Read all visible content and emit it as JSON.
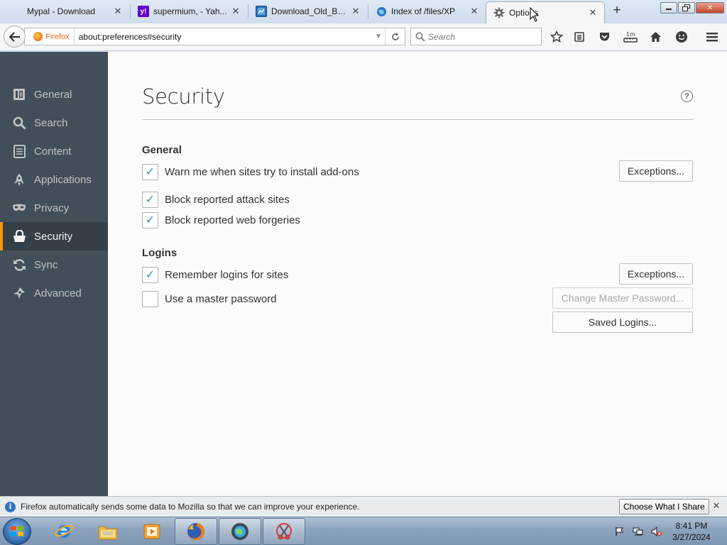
{
  "tabs": [
    {
      "title": "Mypal - Download",
      "icon": "mypal-site-icon"
    },
    {
      "title": "supermium, - Yah...",
      "icon": "yahoo-icon"
    },
    {
      "title": "Download_Old_Bui...",
      "icon": "download-site-icon"
    },
    {
      "title": "Index of /files/XP",
      "icon": "globe-icon"
    },
    {
      "title": "Options",
      "icon": "gear-icon"
    }
  ],
  "navbar": {
    "identity_label": "Firefox",
    "url": "about:preferences#security",
    "search_placeholder": "Search"
  },
  "sidebar": {
    "items": [
      {
        "label": "General",
        "icon": "general-icon"
      },
      {
        "label": "Search",
        "icon": "search-icon"
      },
      {
        "label": "Content",
        "icon": "content-icon"
      },
      {
        "label": "Applications",
        "icon": "applications-icon"
      },
      {
        "label": "Privacy",
        "icon": "privacy-mask-icon"
      },
      {
        "label": "Security",
        "icon": "security-icon",
        "selected": true
      },
      {
        "label": "Sync",
        "icon": "sync-icon"
      },
      {
        "label": "Advanced",
        "icon": "advanced-icon"
      }
    ]
  },
  "page": {
    "title": "Security",
    "help": "?"
  },
  "general": {
    "title": "General",
    "warn_addons": {
      "label": "Warn me when sites try to install add-ons",
      "checked": true
    },
    "exceptions_label": "Exceptions...",
    "block_attack": {
      "label": "Block reported attack sites",
      "checked": true
    },
    "block_forgeries": {
      "label": "Block reported web forgeries",
      "checked": true
    }
  },
  "logins": {
    "title": "Logins",
    "remember": {
      "label": "Remember logins for sites",
      "checked": true
    },
    "exceptions_label": "Exceptions...",
    "master_password": {
      "label": "Use a master password",
      "checked": false
    },
    "change_master_label": "Change Master Password...",
    "saved_logins_label": "Saved Logins..."
  },
  "notification": {
    "message": "Firefox automatically sends some data to Mozilla so that we can improve your experience.",
    "button": "Choose What I Share"
  },
  "taskbar": {
    "time": "8:41 PM",
    "date": "3/27/2024"
  },
  "colors": {
    "sidebar_bg": "#424f5a",
    "sidebar_selected_accent": "#ff9500",
    "checkmark": "#2b8fbe"
  }
}
